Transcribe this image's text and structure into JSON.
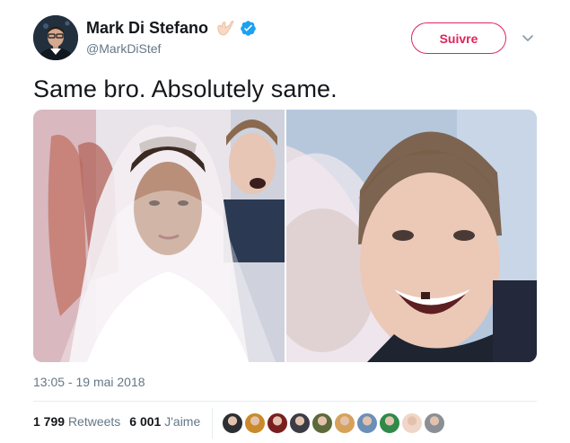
{
  "tweet": {
    "author": {
      "name": "Mark Di Stefano",
      "handle": "@MarkDiStef",
      "name_emoji": "call-me-hand-emoji",
      "verified": true
    },
    "follow_label": "Suivre",
    "text": "Same bro. Absolutely same.",
    "timestamp": "13:05 - 19 mai 2018",
    "retweets": {
      "count": "1 799",
      "label": "Retweets"
    },
    "likes": {
      "count": "6 001",
      "label": "J'aime"
    },
    "likers": [
      {
        "name": "liker-1",
        "color": "#2b2f33"
      },
      {
        "name": "liker-2",
        "color": "#c98a2a"
      },
      {
        "name": "liker-3",
        "color": "#7a1f1f"
      },
      {
        "name": "liker-4",
        "color": "#3c3c46"
      },
      {
        "name": "liker-5",
        "color": "#5b6a3a"
      },
      {
        "name": "liker-6",
        "color": "#d6a25a"
      },
      {
        "name": "liker-7",
        "color": "#6b8fb7"
      },
      {
        "name": "liker-8",
        "color": "#2f8a4a"
      },
      {
        "name": "liker-9",
        "color": "#f0d6c8"
      },
      {
        "name": "liker-10",
        "color": "#8a8f96"
      }
    ]
  },
  "colors": {
    "follow_accent": "#e0245e",
    "verified_blue": "#1da1f2",
    "text_primary": "#14171a",
    "text_secondary": "#657786",
    "divider": "#e6ecf0"
  }
}
